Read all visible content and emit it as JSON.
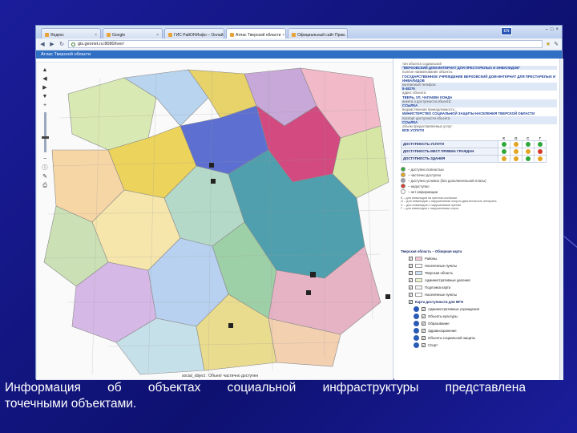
{
  "browser": {
    "tabs": [
      {
        "label": "Яндекс"
      },
      {
        "label": "Google"
      },
      {
        "label": "ГИС РайОНИнфо – Онлай..."
      },
      {
        "label": "Атлас Тверской области"
      },
      {
        "label": "Официальный сайт Прав..."
      }
    ],
    "lang_button": "EN",
    "url": "gis.geonet.ru:8080/tver/",
    "window_controls": [
      "–",
      "□",
      "×"
    ]
  },
  "app": {
    "header_title": "Атлас Тверской области"
  },
  "map": {
    "status_text": "social_object : Объект частично доступен",
    "toolbar_icons": [
      "pan-up-icon",
      "pan-left-icon",
      "pan-right-icon",
      "pan-down-icon",
      "zoom-in-icon",
      "zoom-out-icon",
      "info-icon"
    ]
  },
  "info_panel": {
    "rows": [
      {
        "label": "тип объекта социальной",
        "value": ""
      },
      {
        "label": "",
        "value": "\"ВЕРХОВСКИЙ ДОМ-ИНТЕРНАТ ДЛЯ ПРЕСТАРЕЛЫХ И ИНВАЛИДОВ\""
      },
      {
        "label": "полное наименование объекта:",
        "value": "ГОСУДАРСТВЕННОЕ УЧРЕЖДЕНИЕ ВЕРХОВСКИЙ ДОМ-ИНТЕРНАТ ДЛЯ ПРЕСТАРЕЛЫХ И ИНВАЛИДОВ"
      },
      {
        "label": "контактный телефон:",
        "value": "8-48276"
      },
      {
        "label": "адрес объекта:",
        "value": "ТВЕРЬ, УЛ. ЧАПАЕВА КОНДА"
      },
      {
        "label": "анкета о доступности объекта:",
        "value": "ССЫЛКА"
      },
      {
        "label": "ведомственная принадлежность:",
        "value": "МИНИСТЕРСТВО СОЦИАЛЬНОЙ ЗАЩИТЫ НАСЕЛЕНИЯ ТВЕРСКОЙ ОБЛАСТИ"
      },
      {
        "label": "паспорт доступности объекта:",
        "value": "ССЫЛКА"
      },
      {
        "label": "объем предоставляемых услуг:",
        "value": "ВСЕ УСЛУГИ"
      }
    ]
  },
  "accessibility_table": {
    "headers": [
      "К",
      "О",
      "С",
      "Г"
    ],
    "rows": [
      {
        "name": "ДОСТУПНОСТЬ УСЛУГИ",
        "cells": [
          "#2fa83a",
          "#e3a522",
          "#2fa83a",
          "#2fa83a"
        ]
      },
      {
        "name": "ДОСТУПНОСТЬ МЕСТ ПРИЕМА ГРАЖДАН",
        "cells": [
          "#2fa83a",
          "#e3a522",
          "#e3a522",
          "#d33a2a"
        ]
      },
      {
        "name": "ДОСТУПНОСТЬ ЗДАНИЯ",
        "cells": [
          "#e3a522",
          "#e3a522",
          "#2fa83a",
          "#e3a522"
        ]
      }
    ]
  },
  "legend": {
    "items": [
      {
        "color": "#2fa83a",
        "label": "– доступно полностью"
      },
      {
        "color": "#e3a522",
        "label": "– частично доступно"
      },
      {
        "color": "#9aa0a8",
        "label": "– доступно условно (без дополнительной платы)"
      },
      {
        "color": "#d33a2a",
        "label": "– недоступно"
      },
      {
        "color": "#ffffff",
        "label": "– нет информации"
      }
    ],
    "notes": [
      "К – для инвалидов на креслах-колясках",
      "О – для инвалидов с нарушениями опорно-двигательного аппарата",
      "С – для инвалидов с нарушениями зрения",
      "Г – для инвалидов с нарушениями слуха"
    ]
  },
  "layers": {
    "title": "Тверская область – Обзорная карта",
    "items": [
      {
        "label": "Районы",
        "swatch": "#f4c6d4"
      },
      {
        "label": "Населенные пункты",
        "swatch": "#ffffff"
      },
      {
        "label": "Тверская область",
        "swatch": "#cfe3f7"
      },
      {
        "label": "Административные деления",
        "swatch": "#e9f2c9"
      },
      {
        "label": "Подложка карта",
        "swatch": "#f5f5f5"
      },
      {
        "label": "Населённые пункты",
        "swatch": "#ffffff"
      }
    ],
    "subtitle": "Карта доступности для МГН",
    "sub_items": [
      {
        "label": "Административные учреждения"
      },
      {
        "label": "Объекты культуры"
      },
      {
        "label": "Образование"
      },
      {
        "label": "Здравоохранение"
      },
      {
        "label": "Объекты социальной защиты"
      },
      {
        "label": "Спорт"
      }
    ]
  },
  "caption": {
    "line1_words": [
      "Информация",
      "об",
      "объектах",
      "социальной",
      "инфраструктуры",
      "представлена"
    ],
    "line2": "точечными объектами."
  }
}
